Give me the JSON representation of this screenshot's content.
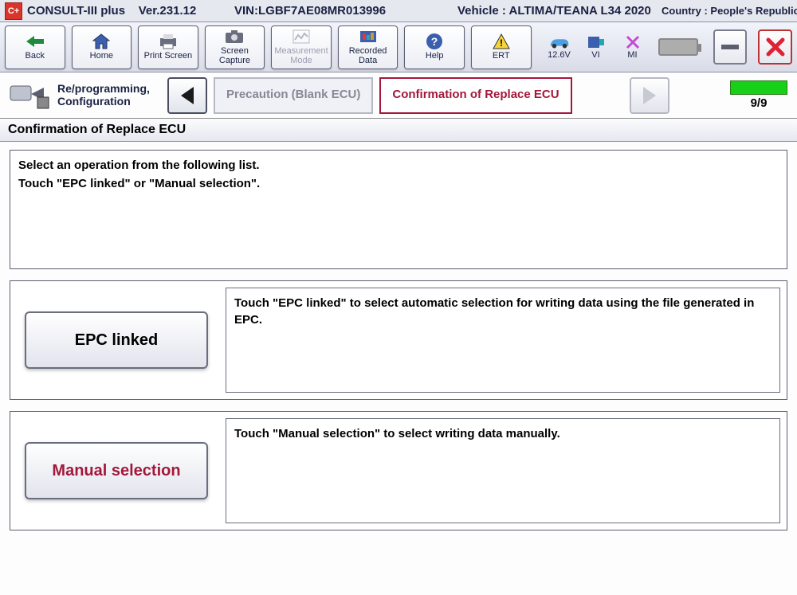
{
  "app": {
    "name": "CONSULT-III plus",
    "version": "Ver.231.12",
    "vin_label": "VIN:",
    "vin": "LGBF7AE08MR013996",
    "vehicle_label": "Vehicle :",
    "vehicle": "ALTIMA/TEANA L34 2020",
    "country_label": "Country :",
    "country": "People's Republic of China"
  },
  "toolbar": {
    "back": "Back",
    "home": "Home",
    "print": "Print Screen",
    "capture": "Screen Capture",
    "measurement": "Measurement Mode",
    "recorded": "Recorded Data",
    "help": "Help",
    "ert": "ERT"
  },
  "status": {
    "voltage": "12.6V",
    "vi": "VI",
    "mi": "MI"
  },
  "nav": {
    "mode": "Re/programming, Configuration",
    "prev_crumb": "Precaution (Blank ECU)",
    "current_crumb": "Confirmation of Replace ECU",
    "progress": "9/9"
  },
  "page": {
    "title": "Confirmation of Replace ECU",
    "instruction_line1": "Select an operation from the following list.",
    "instruction_line2": "Touch \"EPC linked\" or \"Manual selection\".",
    "options": [
      {
        "button": "EPC linked",
        "desc": "Touch \"EPC linked\" to select automatic selection for writing data using the file generated in EPC."
      },
      {
        "button": "Manual selection",
        "desc": "Touch \"Manual selection\" to select writing data manually."
      }
    ]
  }
}
